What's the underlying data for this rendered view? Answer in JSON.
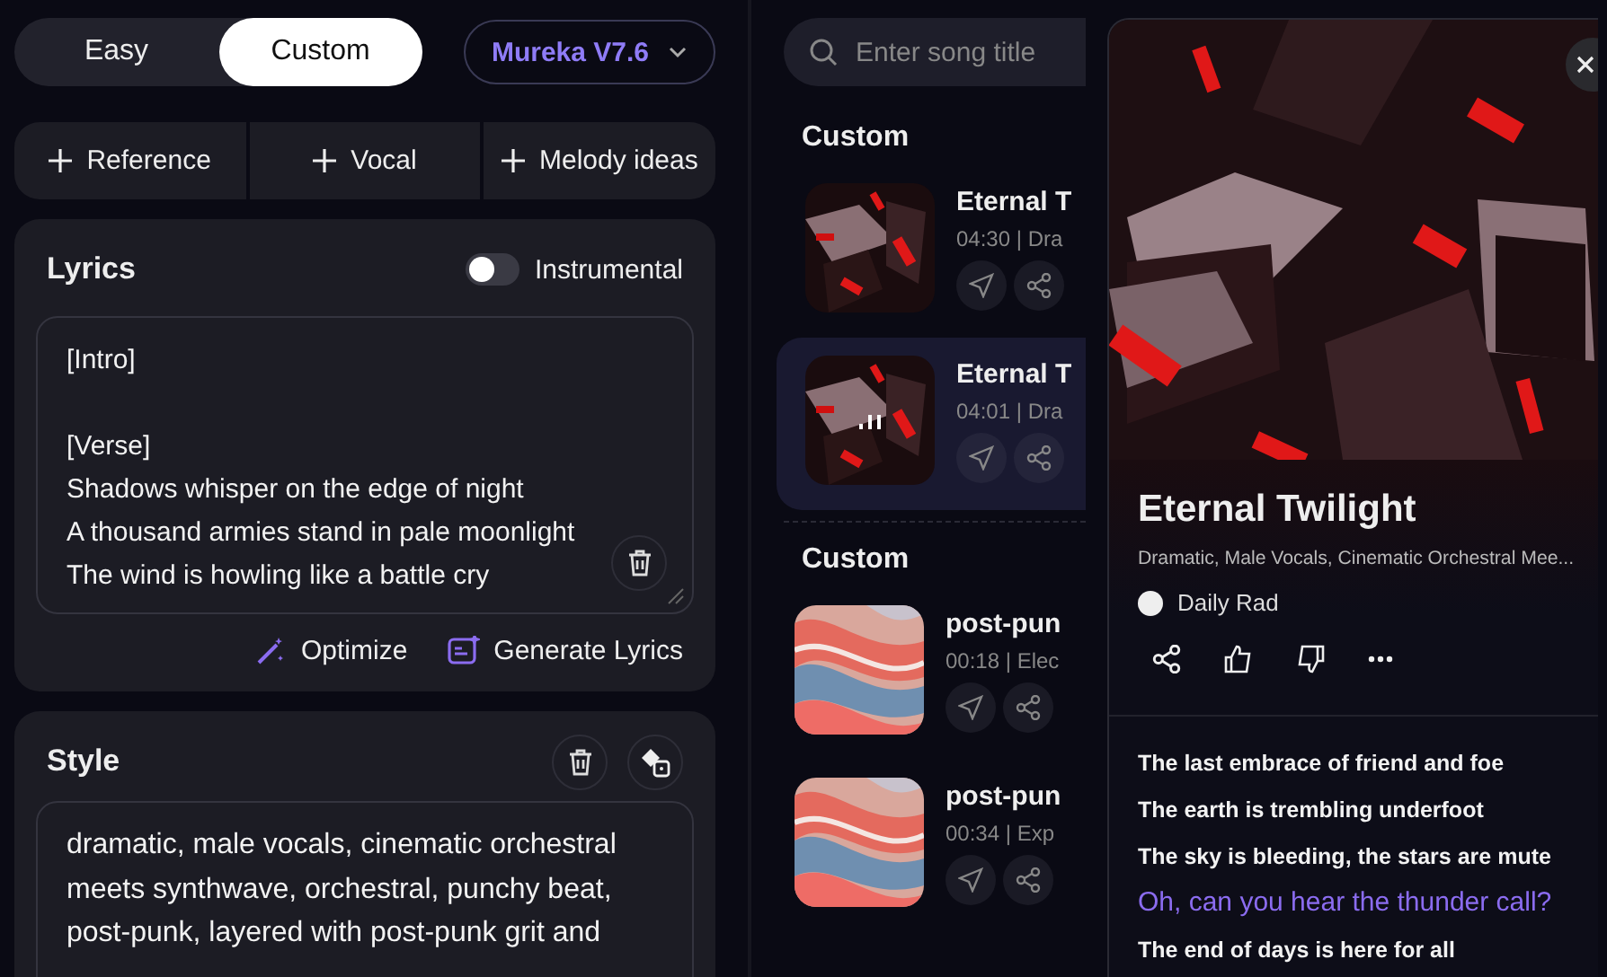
{
  "mode_tabs": [
    {
      "label": "Easy",
      "selected": false
    },
    {
      "label": "Custom",
      "selected": true
    }
  ],
  "model_select": {
    "value": "Mureka V7.6"
  },
  "add_buttons": [
    "Reference",
    "Vocal",
    "Melody ideas"
  ],
  "lyrics": {
    "title": "Lyrics",
    "instrumental": {
      "label": "Instrumental",
      "on": false
    },
    "text": "[Intro]\n\n[Verse]\nShadows whisper on the edge of night\nA thousand armies stand in pale moonlight\nThe wind is howling like a battle cry",
    "actions": [
      {
        "kind": "optimize",
        "label": "Optimize"
      },
      {
        "kind": "generate",
        "label": "Generate Lyrics"
      }
    ]
  },
  "style": {
    "title": "Style",
    "text": "dramatic, male vocals, cinematic orchestral meets synthwave, orchestral, punchy beat, post-punk, layered with post-punk grit and"
  },
  "search": {
    "placeholder": "Enter song title"
  },
  "song_groups": [
    {
      "title": "Custom",
      "songs": [
        {
          "title": "Eternal T",
          "meta": "04:30 | Dra",
          "selected": false,
          "playing": false
        },
        {
          "title": "Eternal T",
          "meta": "04:01 | Dra",
          "selected": true,
          "playing": true
        }
      ]
    },
    {
      "title": "Custom",
      "songs": [
        {
          "title": "post-pun",
          "meta": "00:18 | Elec",
          "selected": false,
          "playing": false
        },
        {
          "title": "post-pun",
          "meta": "00:34 | Exp",
          "selected": false,
          "playing": false
        }
      ]
    }
  ],
  "detail": {
    "title": "Eternal Twilight",
    "tags": "Dramatic, Male Vocals, Cinematic Orchestral Mee...",
    "author": "Daily Rad",
    "lyrics": [
      {
        "text": "The last embrace of friend and foe",
        "active": false
      },
      {
        "text": "The earth is trembling underfoot",
        "active": false
      },
      {
        "text": "The sky is bleeding, the stars are mute",
        "active": false
      },
      {
        "text": "Oh, can you hear the thunder call?",
        "active": true
      },
      {
        "text": "The end of days is here for all",
        "active": false
      }
    ]
  }
}
